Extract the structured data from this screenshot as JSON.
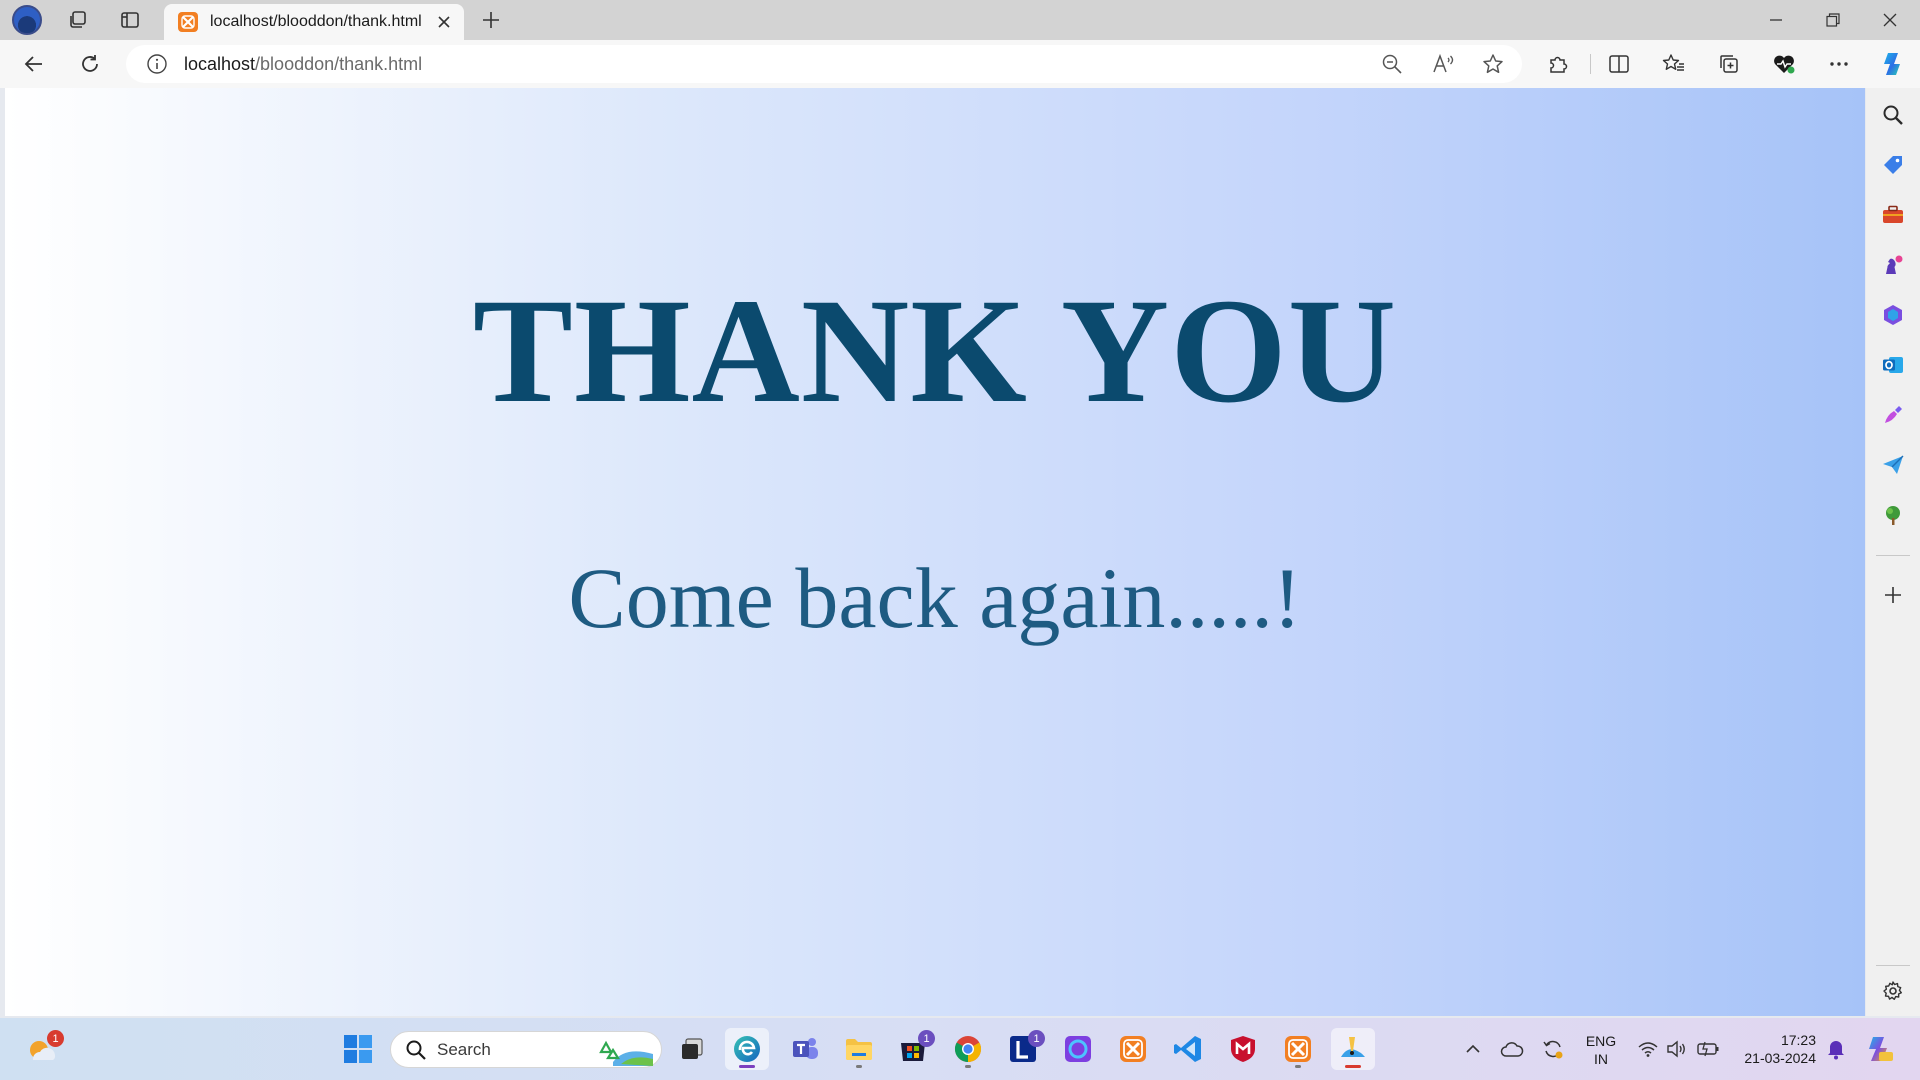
{
  "browser": {
    "tab": {
      "title": "localhost/blooddon/thank.html"
    },
    "address": {
      "host": "localhost",
      "path": "/blooddon/thank.html"
    }
  },
  "page": {
    "headline": "THANK YOU",
    "subline": "Come back again.....!",
    "background_colors": [
      "#ffffff",
      "#dde8fb",
      "#a6c3f8"
    ],
    "text_color": "#0b4a6e"
  },
  "taskbar": {
    "search_label": "Search",
    "badges": {
      "weather": "1",
      "store": "1",
      "linkedin": "1"
    },
    "language": {
      "line1": "ENG",
      "line2": "IN"
    },
    "clock": {
      "time": "17:23",
      "date": "21-03-2024"
    }
  }
}
